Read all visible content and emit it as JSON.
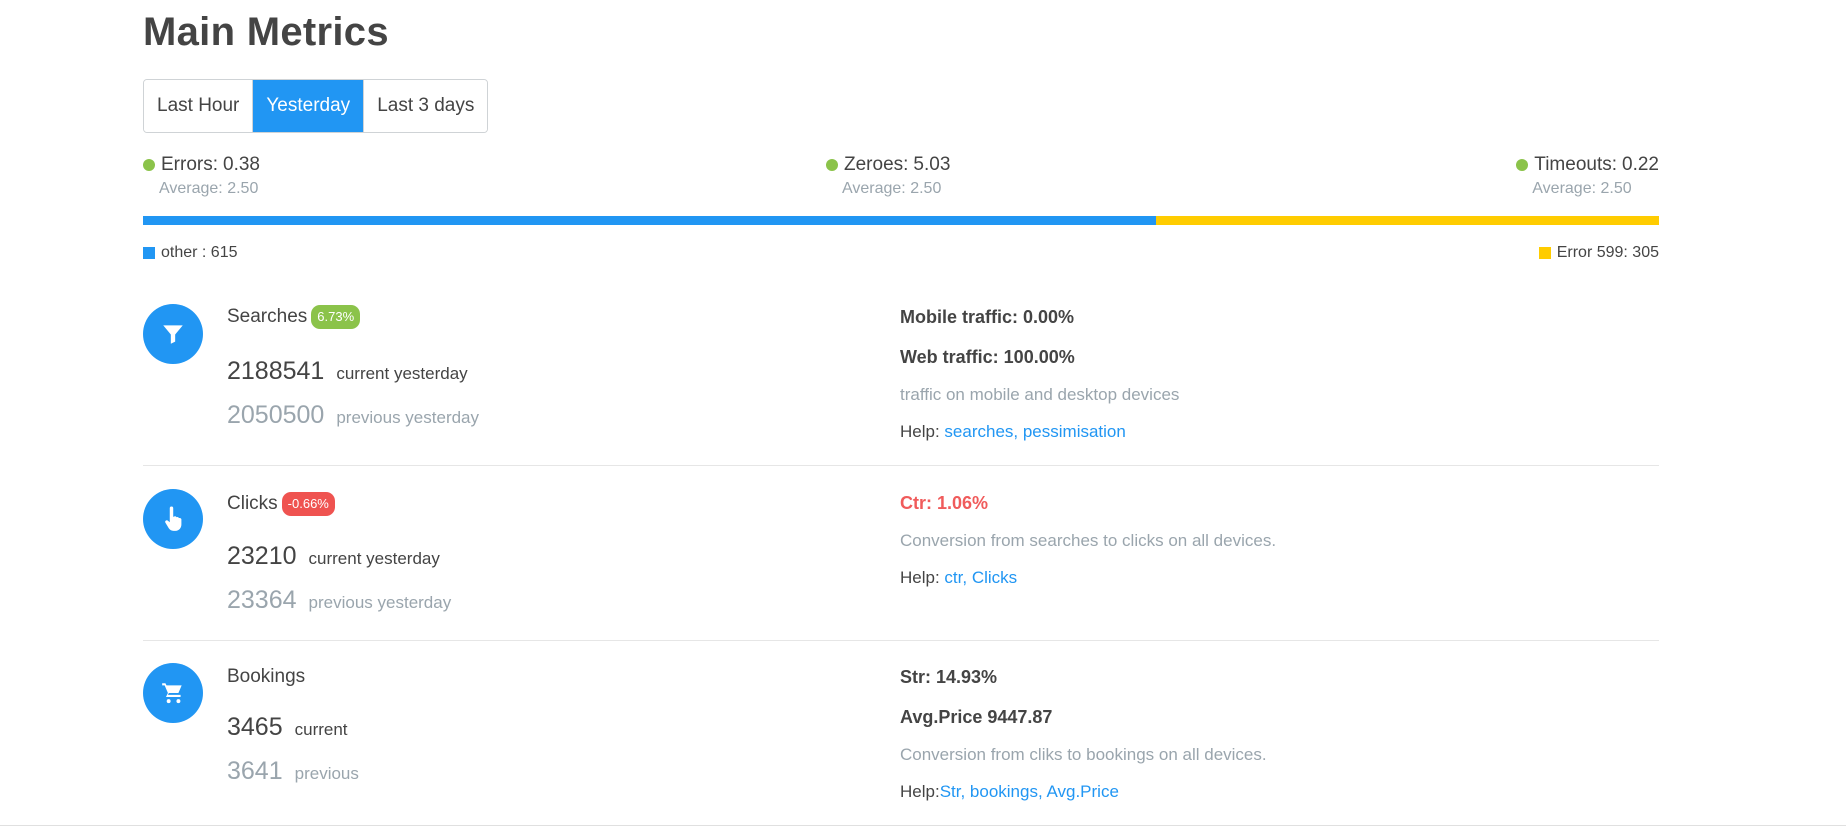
{
  "title": "Main Metrics",
  "periods": [
    {
      "label": "Last Hour",
      "active": false
    },
    {
      "label": "Yesterday",
      "active": true
    },
    {
      "label": "Last 3 days",
      "active": false
    }
  ],
  "stats": [
    {
      "label": "Errors:",
      "value": "0.38",
      "avg": "Average: 2.50"
    },
    {
      "label": "Zeroes:",
      "value": "5.03",
      "avg": "Average: 2.50"
    },
    {
      "label": "Timeouts:",
      "value": "0.22",
      "avg": "Average: 2.50"
    }
  ],
  "distribution": {
    "segments": [
      {
        "label": "other : 615",
        "count": 615,
        "color": "#2196f3"
      },
      {
        "label": "Error 599: 305",
        "count": 305,
        "color": "#ffcc00"
      }
    ],
    "blue_fraction": 0.6685
  },
  "metrics": {
    "searches": {
      "title": "Searches",
      "badge": "6.73%",
      "current_value": "2188541",
      "current_label": "current yesterday",
      "previous_value": "2050500",
      "previous_label": "previous yesterday",
      "mobile": "Mobile traffic: 0.00%",
      "web": "Web traffic: 100.00%",
      "note": "traffic on mobile and desktop devices",
      "help_label": "Help:",
      "help_links": "searches, pessimisation"
    },
    "clicks": {
      "title": "Clicks",
      "badge": "-0.66%",
      "current_value": "23210",
      "current_label": "current yesterday",
      "previous_value": "23364",
      "previous_label": "previous yesterday",
      "ctr": "Ctr: 1.06%",
      "note": "Conversion from searches to clicks on all devices.",
      "help_label": "Help:",
      "help_links": "ctr, Clicks"
    },
    "bookings": {
      "title": "Bookings",
      "current_value": "3465",
      "current_label": "current",
      "previous_value": "3641",
      "previous_label": "previous",
      "str": "Str: 14.93%",
      "avg_price": "Avg.Price 9447.87",
      "note": "Conversion from cliks to bookings on all devices.",
      "help_label": "Help:",
      "help_links": "Str, bookings, Avg.Price"
    }
  },
  "icons": {
    "searches": "filter-icon",
    "clicks": "touch-icon",
    "bookings": "cart-icon"
  }
}
